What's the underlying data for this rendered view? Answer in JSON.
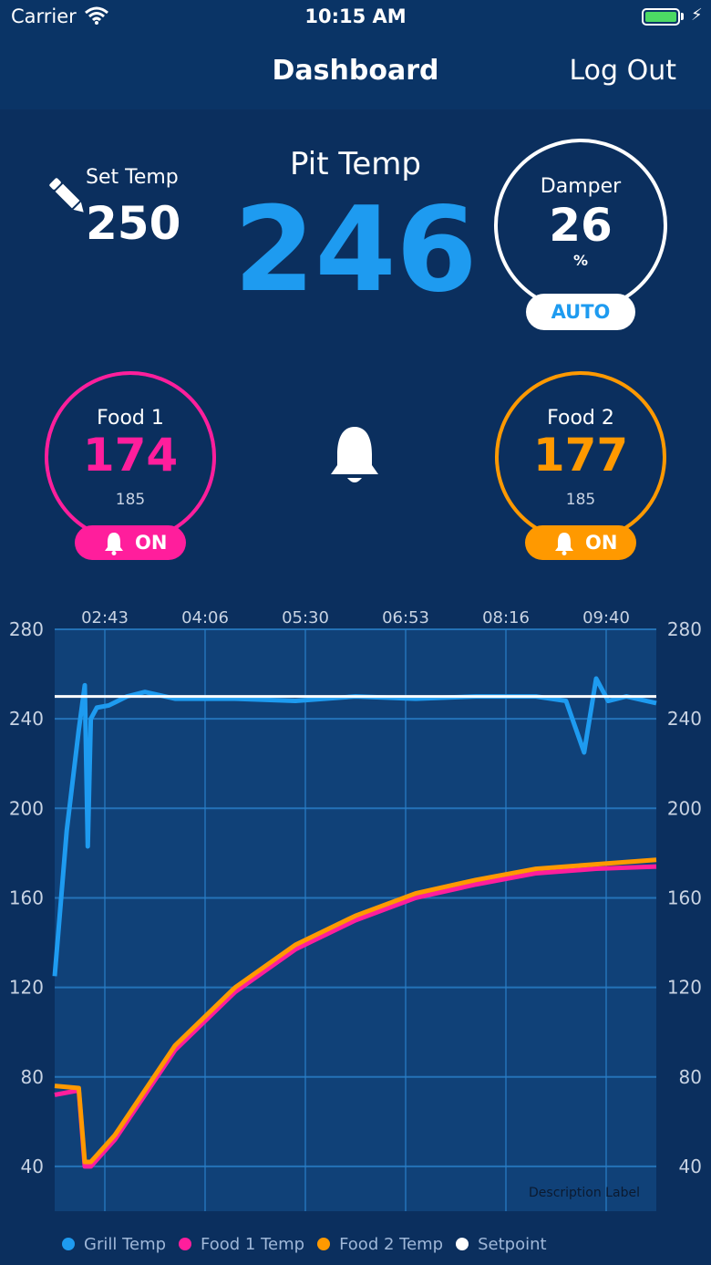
{
  "status_bar": {
    "carrier": "Carrier",
    "time": "10:15 AM"
  },
  "nav": {
    "title": "Dashboard",
    "logout_label": "Log Out"
  },
  "set_temp": {
    "label": "Set Temp",
    "value": "250"
  },
  "pit": {
    "label": "Pit Temp",
    "value": "246"
  },
  "damper": {
    "label": "Damper",
    "value": "26",
    "unit": "%",
    "mode_label": "AUTO",
    "level_percent": 26
  },
  "food1": {
    "label": "Food 1",
    "value": "174",
    "target": "185",
    "alarm_label": "ON",
    "color": "#ff1e9c",
    "progress": 0.94
  },
  "food2": {
    "label": "Food  2",
    "value": "177",
    "target": "185",
    "alarm_label": "ON",
    "color": "#ff9900",
    "progress": 0.96
  },
  "colors": {
    "background": "#0b2f5e",
    "accent_blue": "#1e9bf0",
    "food1": "#ff1e9c",
    "food2": "#ff9900"
  },
  "icons": {
    "pencil": "pencil-icon",
    "bell": "bell-icon",
    "wifi": "wifi-icon",
    "battery": "battery-icon"
  },
  "chart_data": {
    "type": "line",
    "x_ticks": [
      "02:43",
      "04:06",
      "05:30",
      "06:53",
      "08:16",
      "09:40"
    ],
    "ylim": [
      20,
      280
    ],
    "y_ticks": [
      280,
      240,
      200,
      160,
      120,
      80,
      40
    ],
    "description_label": "Description Label",
    "setpoint": 250,
    "series": [
      {
        "name": "Grill Temp",
        "color": "#1e9bf0",
        "x": [
          0.0,
          0.02,
          0.04,
          0.05,
          0.055,
          0.06,
          0.07,
          0.09,
          0.12,
          0.15,
          0.2,
          0.3,
          0.4,
          0.5,
          0.6,
          0.7,
          0.8,
          0.85,
          0.88,
          0.9,
          0.92,
          0.95,
          1.0
        ],
        "values": [
          125,
          190,
          235,
          255,
          183,
          240,
          245,
          246,
          250,
          252,
          249,
          249,
          248,
          250,
          249,
          250,
          250,
          248,
          225,
          258,
          248,
          250,
          247
        ]
      },
      {
        "name": "Food 1 Temp",
        "color": "#ff1e9c",
        "x": [
          0.0,
          0.04,
          0.05,
          0.06,
          0.1,
          0.2,
          0.3,
          0.4,
          0.5,
          0.6,
          0.7,
          0.8,
          0.85,
          0.9,
          1.0
        ],
        "values": [
          72,
          74,
          40,
          40,
          52,
          92,
          118,
          137,
          150,
          160,
          166,
          171,
          172,
          173,
          174
        ]
      },
      {
        "name": "Food 2 Temp",
        "color": "#ff9900",
        "x": [
          0.0,
          0.04,
          0.05,
          0.06,
          0.1,
          0.2,
          0.3,
          0.4,
          0.5,
          0.6,
          0.7,
          0.8,
          0.85,
          0.9,
          1.0
        ],
        "values": [
          76,
          75,
          42,
          42,
          54,
          94,
          120,
          139,
          152,
          162,
          168,
          173,
          174,
          175,
          177
        ]
      },
      {
        "name": "Setpoint",
        "color": "#ffffff",
        "x": [
          0.0,
          1.0
        ],
        "values": [
          250,
          250
        ]
      }
    ],
    "legend": [
      "Grill Temp",
      "Food 1 Temp",
      "Food 2 Temp",
      "Setpoint"
    ],
    "grid": true
  }
}
